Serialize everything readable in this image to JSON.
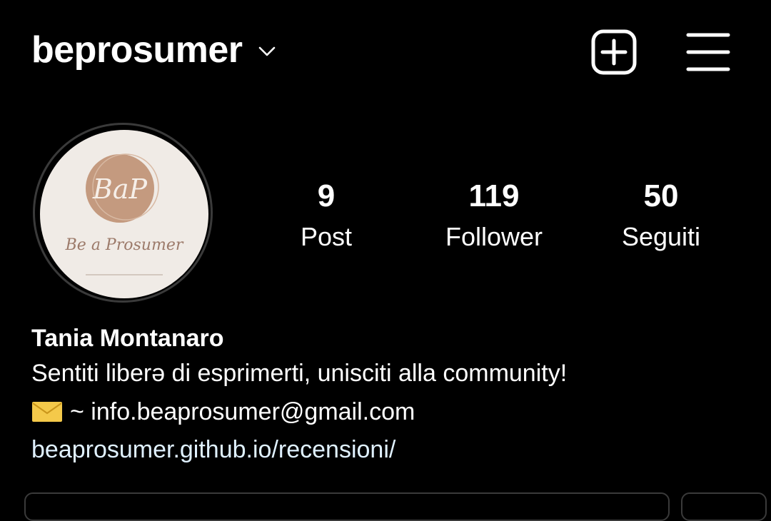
{
  "header": {
    "username": "beprosumer",
    "icons": {
      "dropdown": "chevron-down-icon",
      "new_post": "plus-square-icon",
      "menu": "hamburger-menu-icon"
    }
  },
  "profile": {
    "avatar": {
      "monogram": "BaP",
      "caption": "Be a Prosumer",
      "colors": {
        "background": "#f0ebe6",
        "circle": "#c49a7f",
        "text": "#9c7a6a"
      }
    },
    "stats": [
      {
        "value": "9",
        "label": "Post"
      },
      {
        "value": "119",
        "label": "Follower"
      },
      {
        "value": "50",
        "label": "Seguiti"
      }
    ]
  },
  "bio": {
    "name": "Tania Montanaro",
    "text": "Sentiti liberə di esprimerti, unisciti alla community!",
    "email_prefix": "~ info.beaprosumer@gmail.com",
    "email_icon": "envelope-icon",
    "link": "beaprosumer.github.io/recensioni/"
  },
  "colors": {
    "background": "#000000",
    "text": "#ffffff",
    "link": "#e0f1ff",
    "border": "#3a3a3a",
    "envelope": "#f4c94a"
  }
}
